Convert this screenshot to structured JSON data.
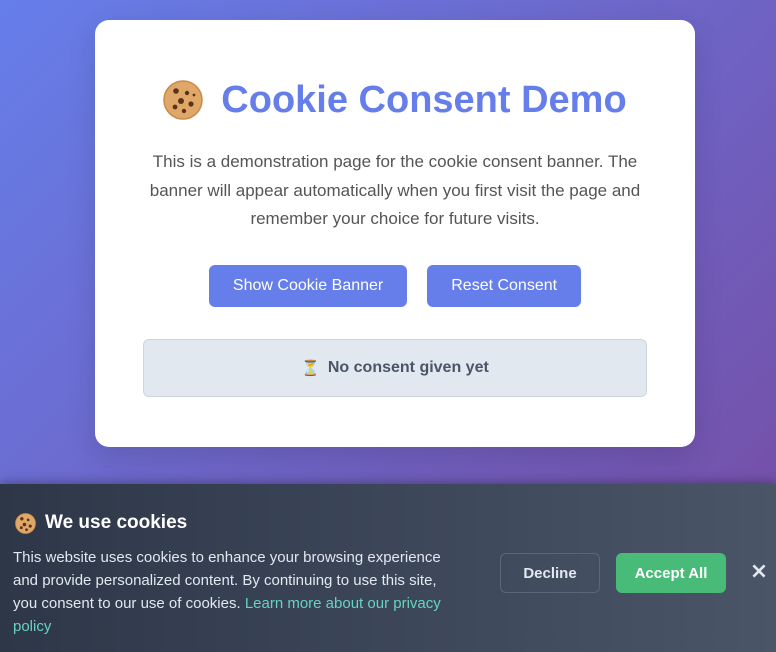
{
  "page": {
    "title": "Cookie Consent Demo",
    "intro": "This is a demonstration page for the cookie consent banner. The banner will appear automatically when you first visit the page and remember your choice for future visits.",
    "show_banner_label": "Show Cookie Banner",
    "reset_consent_label": "Reset Consent",
    "status_icon": "⏳",
    "status_text": "No consent given yet"
  },
  "banner": {
    "title": "We use cookies",
    "text": "This website uses cookies to enhance your browsing experience and provide personalized content. By continuing to use this site, you consent to our use of cookies.",
    "privacy_link": "Learn more about our privacy policy",
    "decline_label": "Decline",
    "accept_label": "Accept All",
    "close_label": "×"
  },
  "icons": {
    "title_icon": "cookie-icon",
    "banner_icon": "cookie-icon",
    "status_icon": "hourglass-icon"
  },
  "colors": {
    "accent": "#667eea",
    "accept": "#48bb78",
    "link": "#68d3c0"
  }
}
